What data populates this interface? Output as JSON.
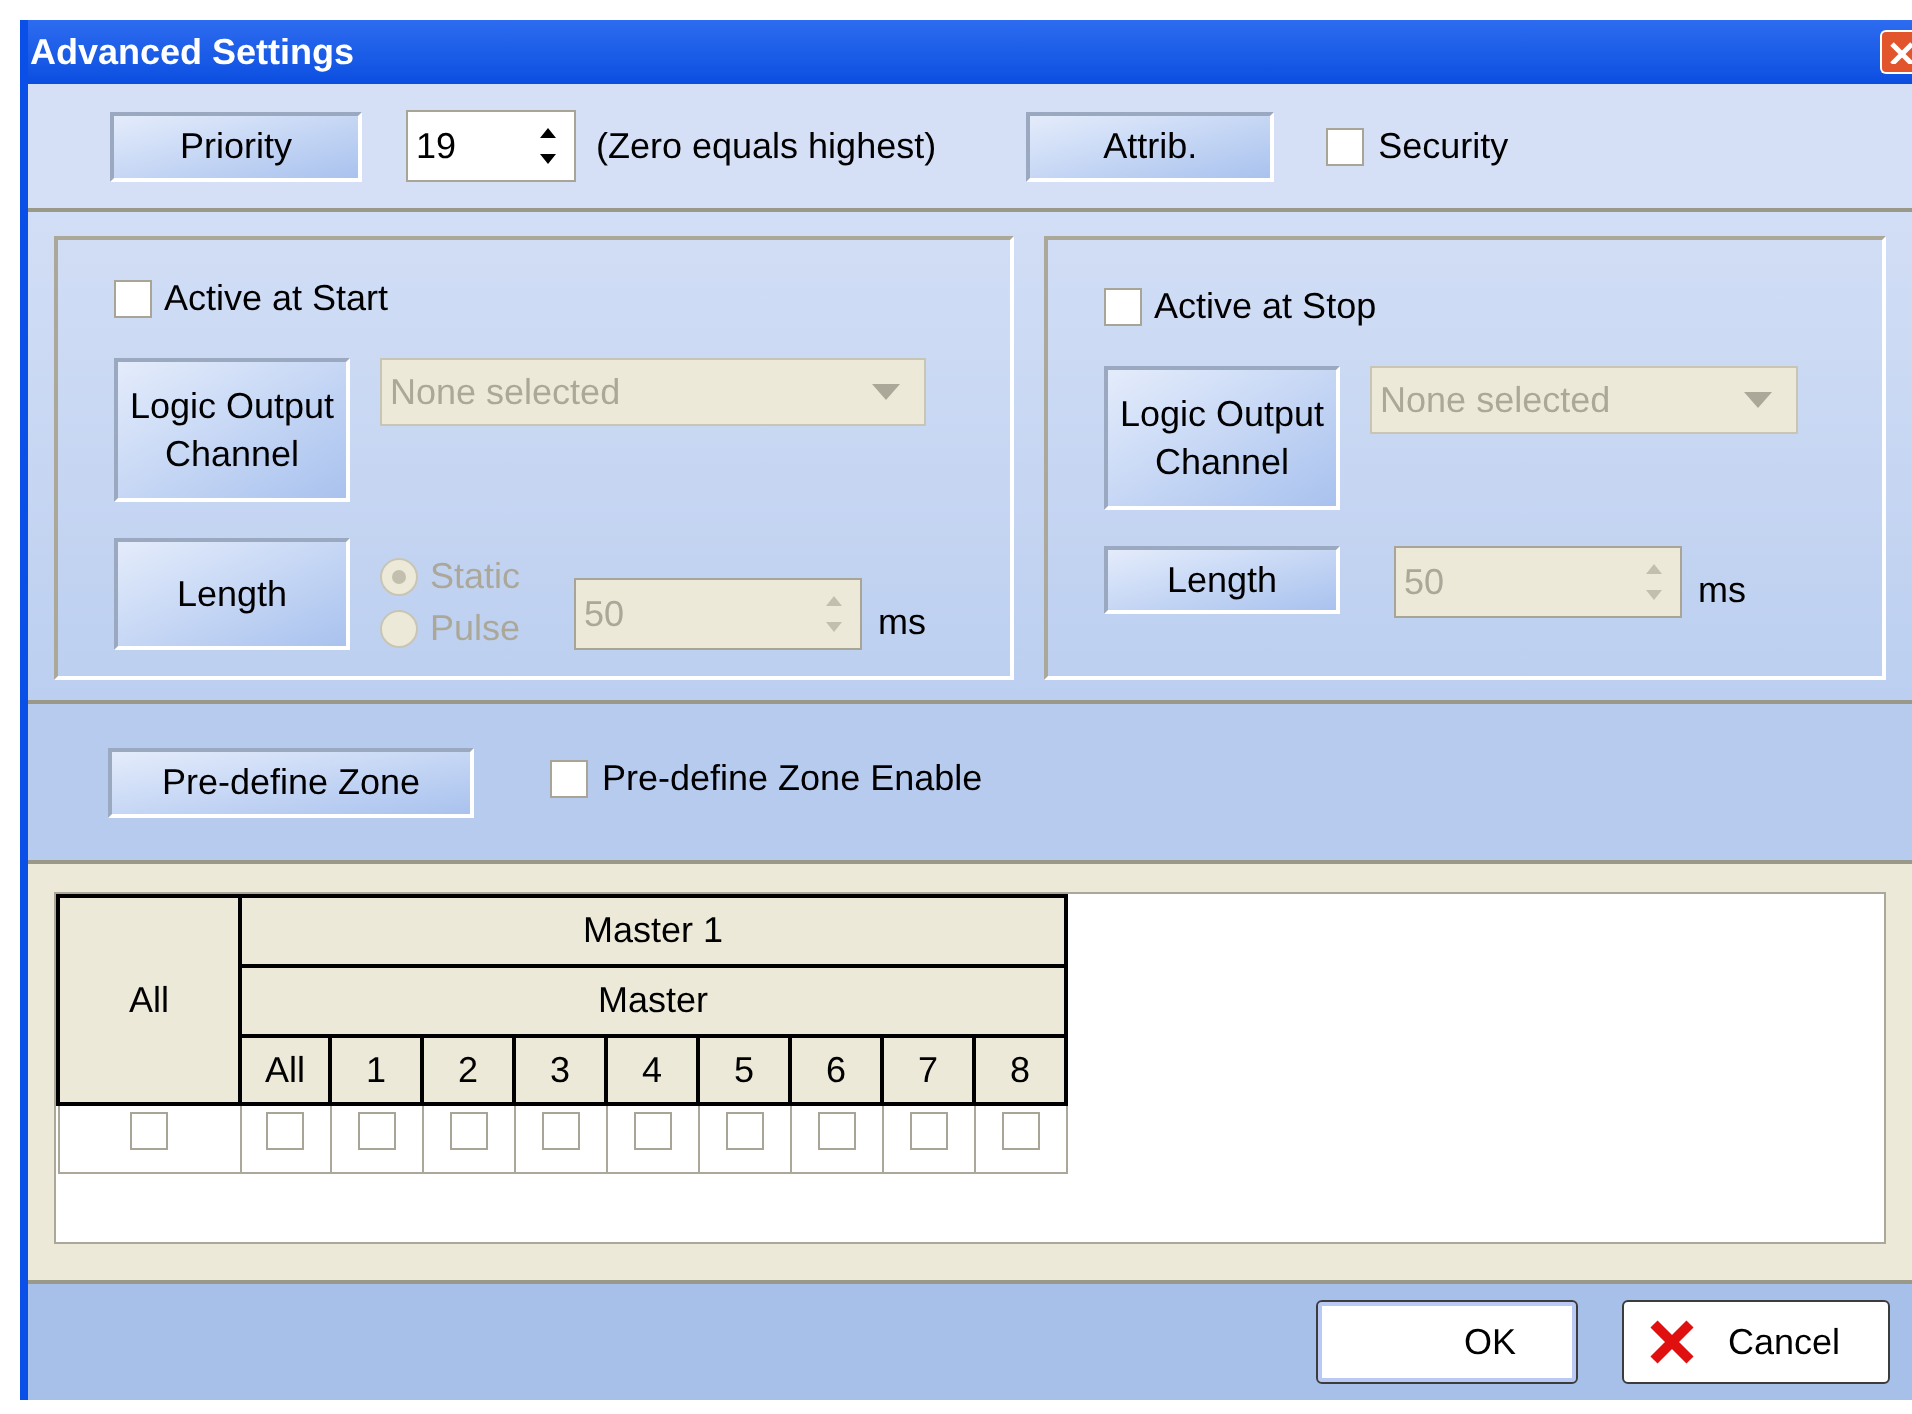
{
  "window": {
    "title": "Advanced Settings"
  },
  "toolbar": {
    "priority_button": "Priority",
    "priority_value": "19",
    "priority_note": "(Zero equals highest)",
    "attrib_button": "Attrib.",
    "security": {
      "label": "Security",
      "checked": false
    }
  },
  "panels": [
    {
      "active": {
        "label": "Active at Start",
        "checked": false
      },
      "channel_button": "Logic Output Channel",
      "channel_dropdown": {
        "value": "None selected",
        "disabled": true
      },
      "length_button": "Length",
      "length_modes": [
        {
          "label": "Static",
          "selected": true
        },
        {
          "label": "Pulse",
          "selected": false
        }
      ],
      "length_value": "50",
      "unit": "ms"
    },
    {
      "active": {
        "label": "Active at Stop",
        "checked": false
      },
      "channel_button": "Logic Output Channel",
      "channel_dropdown": {
        "value": "None selected",
        "disabled": true
      },
      "length_button": "Length",
      "length_value": "50",
      "unit": "ms"
    }
  ],
  "zone": {
    "button": "Pre-define Zone",
    "enable": {
      "label": "Pre-define Zone Enable",
      "checked": false
    }
  },
  "grid": {
    "all_header": "All",
    "group_header": "Master 1",
    "subgroup_header": "Master",
    "columns": [
      "All",
      "1",
      "2",
      "3",
      "4",
      "5",
      "6",
      "7",
      "8"
    ],
    "row": [
      {
        "checked": false
      },
      {
        "checked": false
      },
      {
        "checked": false
      },
      {
        "checked": false
      },
      {
        "checked": false
      },
      {
        "checked": false
      },
      {
        "checked": false
      },
      {
        "checked": false
      },
      {
        "checked": false
      },
      {
        "checked": false
      }
    ]
  },
  "buttons": {
    "ok": "OK",
    "cancel": "Cancel"
  }
}
